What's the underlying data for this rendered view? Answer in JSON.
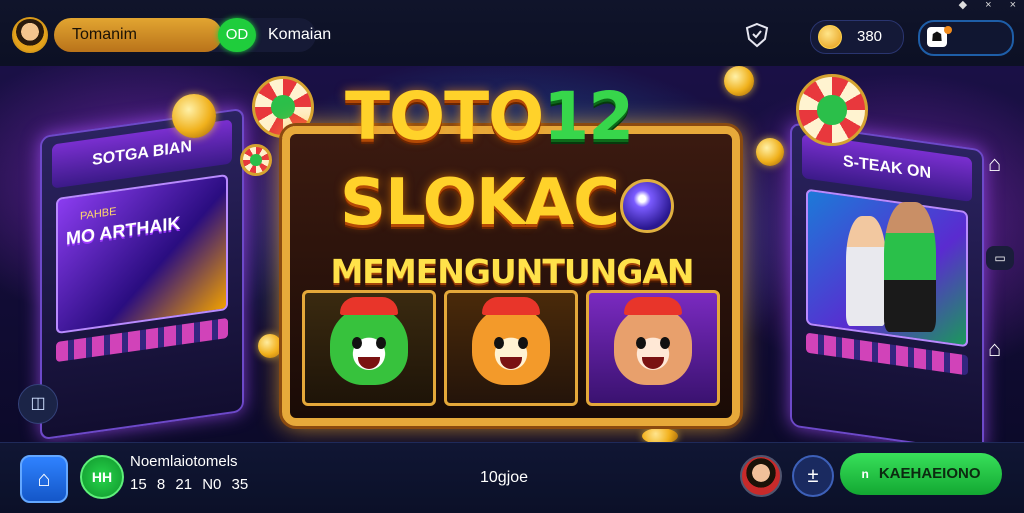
{
  "header": {
    "player_name": "Tomanim",
    "level_badge": "OD",
    "status_label": "Komaian",
    "coins_value": "380",
    "gem_icon_glyph": "☗"
  },
  "system_icons": [
    "◆",
    "×",
    "×"
  ],
  "scene": {
    "title_part1": "TOTO",
    "title_part2": "12",
    "title_line2": "SLOKAC",
    "subtitle": "MEMENGUNTUNGAN",
    "left_cabinet_header": "SOTGA BIAN",
    "left_screen_small": "PAHBE",
    "left_screen_text": "MO ARTHAIK",
    "right_cabinet_header": "S-TEAK ON",
    "reels": [
      {
        "character": "green-cat",
        "hat_color": "#e8352a"
      },
      {
        "character": "orange-hamster",
        "hat_color": "#e8352a"
      },
      {
        "character": "bear",
        "hat_color": "#e8352a"
      }
    ],
    "side_icons": {
      "home_top": "⌂",
      "chat": "▭",
      "home_bottom": "⌂"
    },
    "left_round_button": "◫"
  },
  "bottom": {
    "home_glyph": "⌂",
    "badge_label": "HH",
    "info_title": "Noemlaiotomels",
    "info_values": "15 8 21 N0 35",
    "center_label": "10gjoe",
    "plus_glyph": "±",
    "action_label": "KAEHAEIONO",
    "action_icon": "n"
  },
  "colors": {
    "accent_gold": "#e2a531",
    "accent_green": "#1fcd3c",
    "background": "#0b0820",
    "title_yellow": "#ffd22a"
  }
}
